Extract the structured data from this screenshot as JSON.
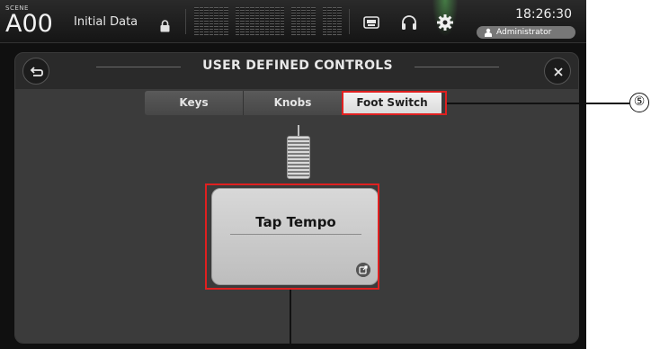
{
  "topbar": {
    "scene_label": "SCENE",
    "scene_number": "A00",
    "scene_title": "Initial Data",
    "time": "18:26:30",
    "user": "Administrator"
  },
  "window": {
    "title": "USER DEFINED CONTROLS",
    "tabs": [
      {
        "label": "Keys",
        "active": false
      },
      {
        "label": "Knobs",
        "active": false
      },
      {
        "label": "Foot Switch",
        "active": true
      }
    ],
    "footswitch": {
      "assignment": "Tap Tempo"
    }
  },
  "annotations": {
    "callout_5": "⑤"
  },
  "colors": {
    "highlight": "#e02020",
    "setup_indicator": "#5abe5a"
  }
}
